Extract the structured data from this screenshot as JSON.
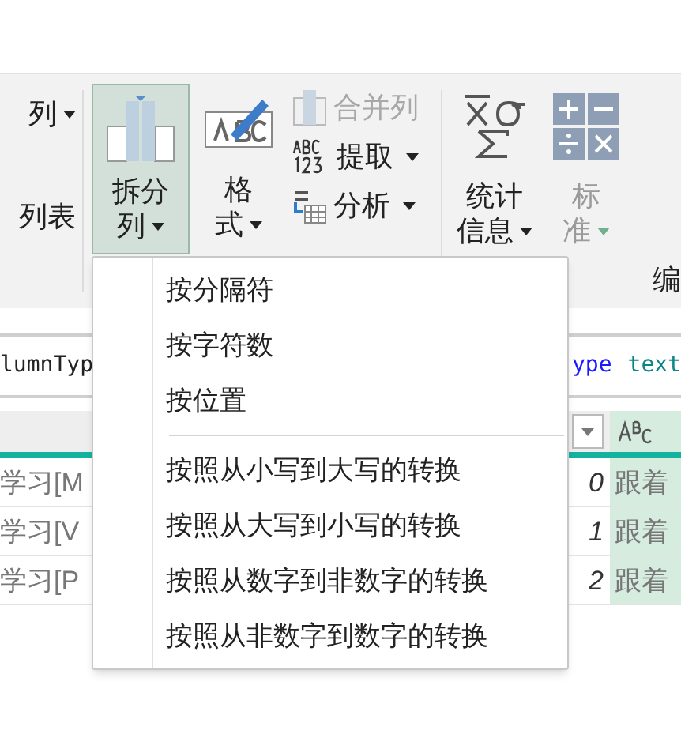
{
  "ribbon": {
    "left_items": [
      {
        "label": "列",
        "dropdown": true
      },
      {
        "label": "列表",
        "dropdown": false
      }
    ],
    "split_button": {
      "line_1": "拆分",
      "line_2": "列",
      "selected": true
    },
    "format_button": {
      "line_1": "格",
      "line_2": "式"
    },
    "small_buttons": [
      {
        "label": "合并列",
        "disabled": true,
        "dropdown": false,
        "kind": "merge"
      },
      {
        "label": "提取",
        "disabled": false,
        "dropdown": true,
        "kind": "extract"
      },
      {
        "label": "分析",
        "disabled": false,
        "dropdown": true,
        "kind": "parse"
      }
    ],
    "stats_button": {
      "line_1": "统计",
      "line_2": "信息"
    },
    "standard_button": {
      "line_1": "标",
      "line_2": "准",
      "disabled": true
    },
    "group_label": "编"
  },
  "formula_bar": {
    "segments": [
      {
        "text": "lumnTyp",
        "kind": "plain"
      },
      {
        "text": "ype",
        "kind": "keyword"
      },
      {
        "text": "text",
        "kind": "type"
      }
    ]
  },
  "table": {
    "rows": [
      {
        "column_1": "学习[M",
        "index": "0",
        "column_3": "跟着"
      },
      {
        "column_1": "学习[V",
        "index": "1",
        "column_3": "跟着"
      },
      {
        "column_1": "学习[P",
        "index": "2",
        "column_3": "跟着"
      }
    ]
  },
  "menu": {
    "groups": [
      [
        "按分隔符",
        "按字符数",
        "按位置"
      ],
      [
        "按照从小写到大写的转换",
        "按照从大写到小写的转换",
        "按照从数字到非数字的转换",
        "按照从非数字到数字的转换"
      ]
    ]
  }
}
